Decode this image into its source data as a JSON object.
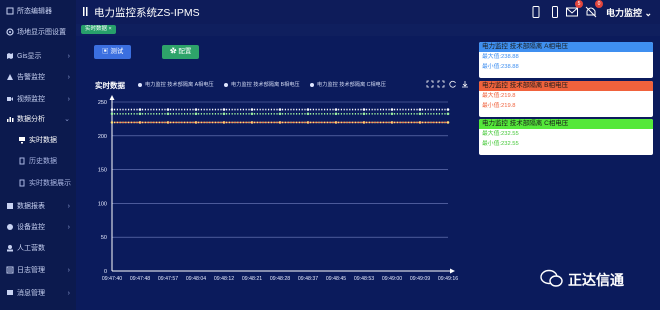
{
  "sidebar": {
    "items": [
      {
        "label": "所态编辑器",
        "arrow": ""
      },
      {
        "label": "场地显示图设置",
        "arrow": ""
      },
      {
        "label": "Gis显示",
        "arrow": "›"
      },
      {
        "label": "告警监控",
        "arrow": "›"
      },
      {
        "label": "视频监控",
        "arrow": "›"
      },
      {
        "label": "数据分析",
        "arrow": "⌄"
      },
      {
        "label": "实时数据",
        "arrow": ""
      },
      {
        "label": "历史数据",
        "arrow": ""
      },
      {
        "label": "实时数据展示",
        "arrow": ""
      },
      {
        "label": "数据报表",
        "arrow": "›"
      },
      {
        "label": "设备监控",
        "arrow": "›"
      },
      {
        "label": "人工营数",
        "arrow": ""
      },
      {
        "label": "日志管理",
        "arrow": "›"
      },
      {
        "label": "消息管理",
        "arrow": "›"
      }
    ]
  },
  "header": {
    "title": "电力监控系统ZS-IPMS",
    "user": "电力监控",
    "user_caret": "⌄",
    "badges": [
      "5",
      "0"
    ],
    "icons": [
      "tablet-icon",
      "phone-icon",
      "mail-icon",
      "bell-icon"
    ]
  },
  "tab": {
    "label": "实时数据 ×"
  },
  "toolbar": {
    "test_label": "测试",
    "config_label": "配置"
  },
  "chart_data": {
    "type": "line",
    "title": "实时数据",
    "legend": [
      "电力监控 技术部隔离 A相电压",
      "电力监控 技术部隔离 B相电压",
      "电力监控 技术部隔离 C相电压"
    ],
    "x": [
      "09:47:40",
      "09:47:48",
      "09:47:57",
      "09:48:04",
      "09:48:12",
      "09:48:21",
      "09:48:28",
      "09:48:37",
      "09:48:45",
      "09:48:53",
      "09:49:00",
      "09:49:09",
      "09:49:16"
    ],
    "yticks": [
      "0",
      "50",
      "100",
      "150",
      "200",
      "250"
    ],
    "ylim": [
      0,
      250
    ],
    "series": [
      {
        "name": "电力监控 技术部隔离 A相电压",
        "color": "#ffffff",
        "value": 238.88
      },
      {
        "name": "电力监控 技术部隔离 B相电压",
        "color": "#ffe07a",
        "value": 219.8
      },
      {
        "name": "电力监控 技术部隔离 C相电压",
        "color": "#9df0a0",
        "value": 232.55
      }
    ]
  },
  "panels": [
    {
      "head": "电力监控 技术部隔离 A相电压",
      "head_color": "#3f8ff0",
      "max": "最大值:238.88",
      "min": "最小值:238.88",
      "text_color": "#3f8ff0"
    },
    {
      "head": "电力监控 技术部隔离 B相电压",
      "head_color": "#f0623c",
      "max": "最大值:219.8",
      "min": "最小值:219.8",
      "text_color": "#f0623c"
    },
    {
      "head": "电力监控 技术部隔离 C相电压",
      "head_color": "#54e83a",
      "max": "最大值:232.55",
      "min": "最小值:232.55",
      "text_color": "#45c838"
    }
  ],
  "watermark": {
    "text": "正达信通"
  },
  "colors": {
    "accent": "#3b6fe0",
    "success": "#2ea36a",
    "bg": "#0b1b5c"
  }
}
